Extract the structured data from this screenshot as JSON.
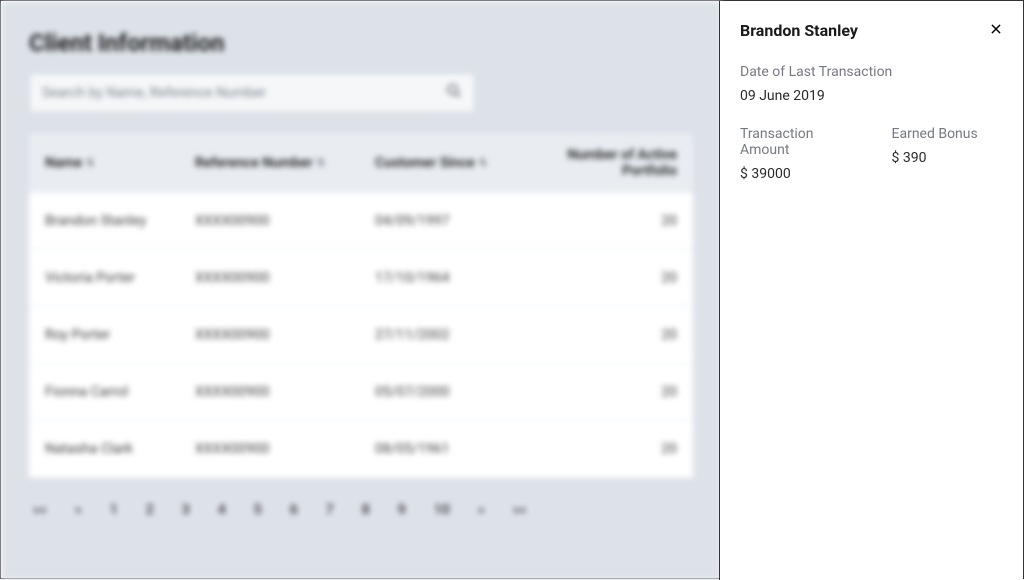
{
  "background": {
    "title": "Client Information",
    "search_placeholder": "Search by Name, Reference Number",
    "columns": {
      "name": "Name",
      "reference": "Reference Number",
      "since": "Customer Since",
      "portfolio": "Number of Active Portfolio"
    },
    "rows": [
      {
        "name": "Brandon Stanley",
        "ref": "XXXX00900",
        "since": "04/09/1997",
        "portfolio": "20"
      },
      {
        "name": "Victoria Porter",
        "ref": "XXXX00900",
        "since": "17/10/1964",
        "portfolio": "20"
      },
      {
        "name": "Roy Porter",
        "ref": "XXXX00900",
        "since": "27/11/2002",
        "portfolio": "20"
      },
      {
        "name": "Fionna Carrol",
        "ref": "XXXX00900",
        "since": "05/07/2000",
        "portfolio": "20"
      },
      {
        "name": "Natasha Clark",
        "ref": "XXXX00900",
        "since": "08/05/1961",
        "portfolio": "20"
      }
    ],
    "pages": [
      "1",
      "2",
      "3",
      "4",
      "5",
      "6",
      "7",
      "8",
      "9",
      "10"
    ]
  },
  "sidepanel": {
    "client_name": "Brandon Stanley",
    "last_transaction_label": "Date of Last Transaction",
    "last_transaction_value": "09 June 2019",
    "amount_label": "Transaction Amount",
    "amount_value": "$ 39000",
    "bonus_label": "Earned Bonus",
    "bonus_value": "$ 390"
  }
}
